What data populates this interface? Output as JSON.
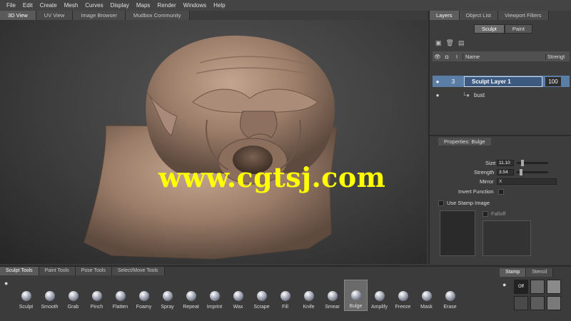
{
  "menu": [
    "File",
    "Edit",
    "Create",
    "Mesh",
    "Curves",
    "Display",
    "Maps",
    "Render",
    "Windows",
    "Help"
  ],
  "view_tabs": [
    {
      "label": "3D View",
      "active": true
    },
    {
      "label": "UV View",
      "active": false
    },
    {
      "label": "Image Browser",
      "active": false
    },
    {
      "label": "Mudbox Community",
      "active": false
    }
  ],
  "watermark": "www.cgtsj.com",
  "right_tabs": [
    {
      "label": "Layers",
      "active": true
    },
    {
      "label": "Object List",
      "active": false
    },
    {
      "label": "Viewport Filters",
      "active": false
    }
  ],
  "layer_mode": {
    "sculpt": "Sculpt",
    "paint": "Paint"
  },
  "layer_columns": {
    "name": "Name",
    "strength": "Strengt"
  },
  "layers": [
    {
      "index": "3",
      "name": "Sculpt Layer 1",
      "strength": "100"
    },
    {
      "name": "bust"
    }
  ],
  "properties": {
    "title": "Properties: Bulge",
    "size_label": "Size",
    "size_value": "11.10",
    "strength_label": "Strength",
    "strength_value": "3.54",
    "mirror_label": "Mirror",
    "mirror_value": "X",
    "invert_label": "Invert Function",
    "stamp_label": "Use Stamp Image",
    "falloff_label": "Falloff"
  },
  "bottom_tabs": [
    {
      "label": "Sculpt Tools",
      "active": true
    },
    {
      "label": "Paint Tools",
      "active": false
    },
    {
      "label": "Pose Tools",
      "active": false
    },
    {
      "label": "Select/Move Tools",
      "active": false
    }
  ],
  "tools": [
    "Sculpt",
    "Smooth",
    "Grab",
    "Pinch",
    "Flatten",
    "Foamy",
    "Spray",
    "Repeat",
    "Imprint",
    "Wax",
    "Scrape",
    "Fill",
    "Knife",
    "Smear",
    "Bulge",
    "Amplify",
    "Freeze",
    "Mask",
    "Erase"
  ],
  "selected_tool": "Bulge",
  "stamp_tabs": [
    {
      "label": "Stamp",
      "active": true
    },
    {
      "label": "Stencil",
      "active": false
    }
  ],
  "stamp_off": "Off",
  "colors": {
    "accent": "#5a7ea5",
    "watermark": "#ffff00",
    "sculpt": "#a08370"
  }
}
